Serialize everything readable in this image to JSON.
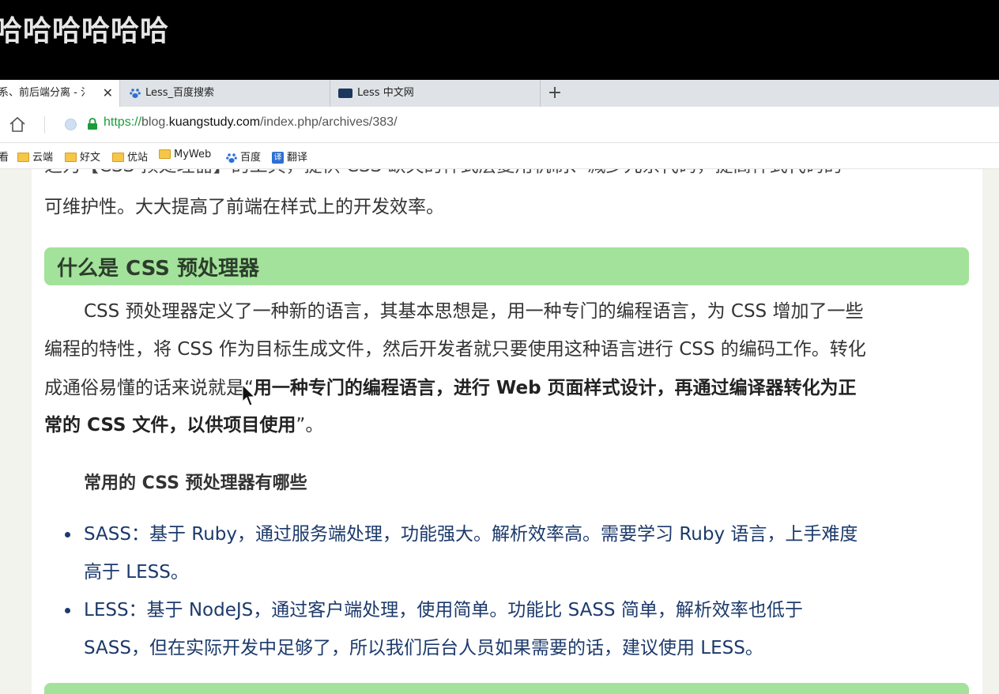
{
  "overlay": {
    "text": "哈哈哈哈哈哈"
  },
  "tabs": [
    {
      "label": "系、前后端分离 - 氵",
      "active": true,
      "close": "✕"
    },
    {
      "label": "Less_百度搜索",
      "active": false
    },
    {
      "label": "Less 中文网",
      "active": false
    }
  ],
  "new_tab": "+",
  "address": {
    "scheme": "https://",
    "domain_prefix": "blog.",
    "domain": "kuangstudy.com",
    "path": "/index.php/archives/383/"
  },
  "bookmarks": [
    {
      "label": "看",
      "icon": "folder-icon"
    },
    {
      "label": "云端",
      "icon": "folder-icon"
    },
    {
      "label": "好文",
      "icon": "folder-icon"
    },
    {
      "label": "优站",
      "icon": "folder-icon"
    },
    {
      "label": "MyWeb",
      "icon": "folder-icon"
    },
    {
      "label": "百度",
      "icon": "baidu-paw-icon"
    },
    {
      "label": "翻译",
      "icon": "translate-icon"
    }
  ],
  "article": {
    "clipped_line": "之为【CSS 预处理器】的工具，提供 CSS 缺失的样式层复用机制、减少冗余代码，提高样式代码的",
    "intro_end": "可维护性。大大提高了前端在样式上的开发效率。",
    "heading1": "什么是 CSS 预处理器",
    "para_line1": "CSS 预处理器定义了一种新的语言，其基本思想是，用一种专门的编程语言，为 CSS 增加了一些",
    "para_line2": "编程的特性，将 CSS 作为目标生成文件，然后开发者就只要使用这种语言进行 CSS 的编码工作。转化",
    "para_line3_start": "成通俗易懂的话来说就是“",
    "para_line3_bold": "用一种专门的编程语言，进行 Web 页面样式设计，再通过编译器转化为正",
    "para_line4_bold": "常的 CSS 文件，以供项目使用",
    "para_line4_end": "”。",
    "heading2": "常用的 CSS 预处理器有哪些",
    "list": [
      {
        "line1": "SASS：基于 Ruby，通过服务端处理，功能强大。解析效率高。需要学习 Ruby 语言，上手难度",
        "line2": "高于 LESS。"
      },
      {
        "line1": "LESS：基于 NodeJS，通过客户端处理，使用简单。功能比 SASS 简单，解析效率也低于",
        "line2": "SASS，但在实际开发中足够了，所以我们后台人员如果需要的话，建议使用 LESS。"
      }
    ]
  },
  "colors": {
    "heading_bg": "#a3e29a",
    "list_text": "#1c3a6b",
    "url_scheme": "#1a9c3a"
  }
}
